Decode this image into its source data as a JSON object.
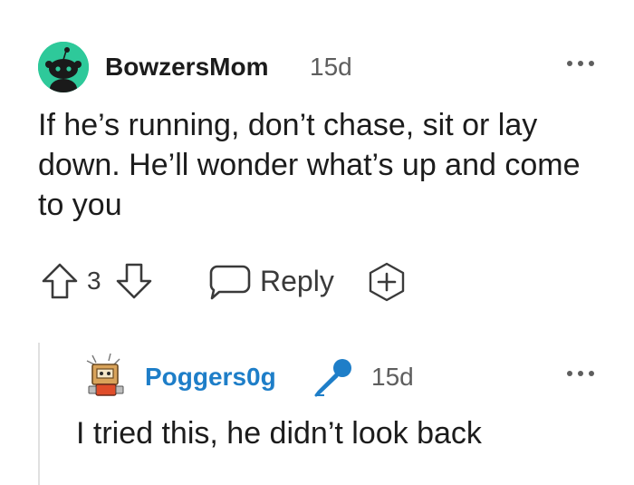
{
  "comments": [
    {
      "username": "BowzersMom",
      "age": "15d",
      "body": "If he’s running, don’t chase, sit or lay down. He’ll wonder what’s up and come to you",
      "vote_count": "3",
      "reply_label": "Reply",
      "avatar_color": "#2ec99a",
      "icons": [
        "upvote-icon",
        "downvote-icon",
        "comment-bubble-icon",
        "award-plus-icon",
        "more-options-icon"
      ]
    },
    {
      "username": "Poggers0g",
      "age": "15d",
      "body": "I tried this, he didn’t look back",
      "username_color": "#1e7ec8",
      "icons": [
        "microphone-icon",
        "more-options-icon"
      ]
    }
  ]
}
